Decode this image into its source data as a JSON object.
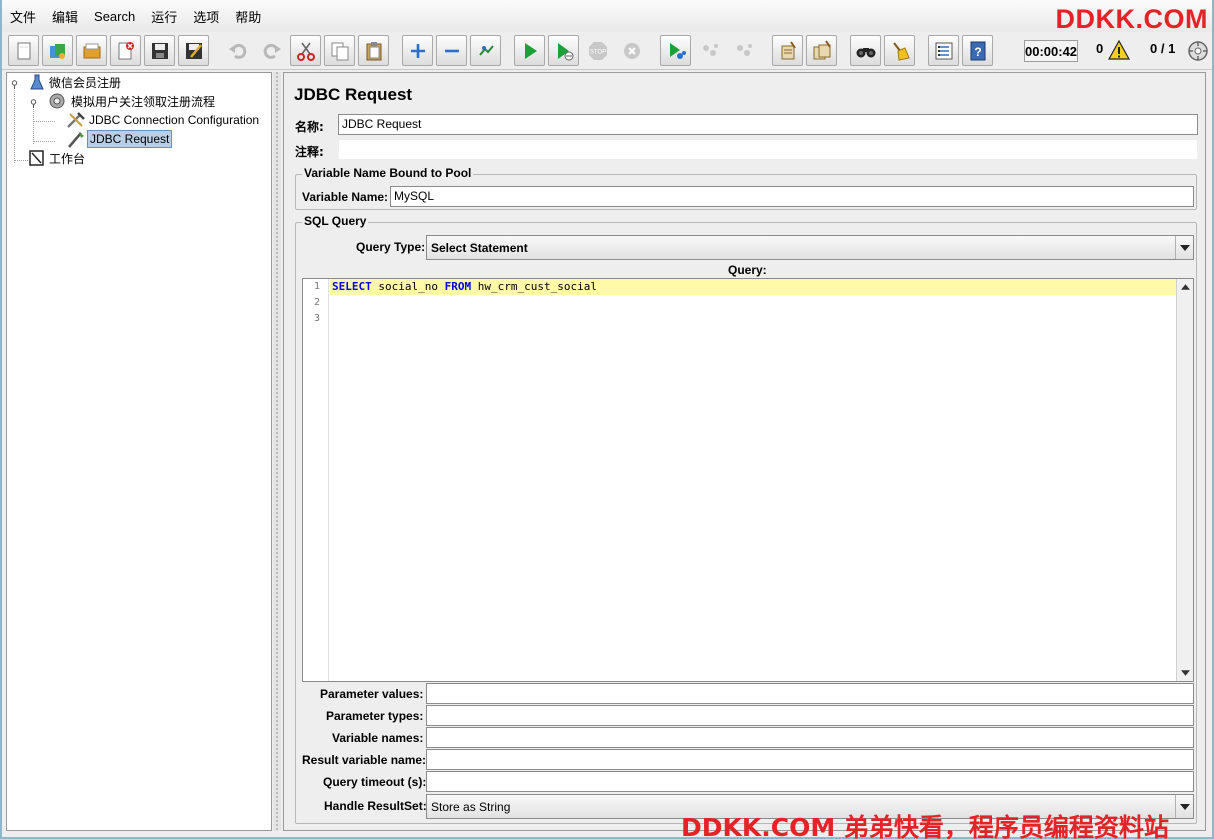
{
  "menu": {
    "items": [
      "文件",
      "编辑",
      "Search",
      "运行",
      "选项",
      "帮助"
    ]
  },
  "watermark": {
    "top": "DDKK.COM",
    "bottom": "DDKK.COM 弟弟快看，程序员编程资料站"
  },
  "toolbar": {
    "buttons": [
      "new-icon",
      "templates-icon",
      "open-icon",
      "close-icon",
      "save-icon",
      "save-as-icon",
      "undo-icon",
      "redo-icon",
      "cut-icon",
      "copy-icon",
      "paste-icon",
      "expand-icon",
      "collapse-icon",
      "toggle-icon",
      "start-icon",
      "start-no-pause-icon",
      "stop-icon",
      "shutdown-icon",
      "remote-start-icon",
      "remote-stop-icon",
      "remote-exit-icon",
      "clear-icon",
      "clear-all-icon",
      "search-icon",
      "reset-search-icon",
      "function-helper-icon",
      "help-icon"
    ],
    "timer": "00:00:42",
    "warnings": "0",
    "threads": "0 / 1"
  },
  "tree": {
    "items": [
      {
        "label": "微信会员注册",
        "icon": "test-plan-icon"
      },
      {
        "label": "模拟用户关注领取注册流程",
        "icon": "thread-group-icon"
      },
      {
        "label": "JDBC Connection Configuration",
        "icon": "config-element-icon"
      },
      {
        "label": "JDBC Request",
        "icon": "sampler-icon",
        "selected": true
      },
      {
        "label": "工作台",
        "icon": "workbench-icon"
      }
    ]
  },
  "panel": {
    "title": "JDBC Request",
    "name_label": "名称:",
    "name_value": "JDBC Request",
    "comment_label": "注释:",
    "comment_value": "",
    "pool_group_title": "Variable Name Bound to Pool",
    "variable_name_label": "Variable Name:",
    "variable_name_value": "MySQL",
    "sql_group_title": "SQL Query",
    "query_type_label": "Query Type:",
    "query_type_value": "Select Statement",
    "query_label": "Query:",
    "query": {
      "line_numbers": [
        "1",
        "2",
        "3"
      ],
      "line1_kw1": "SELECT",
      "line1_t1": " social_no ",
      "line1_kw2": "FROM",
      "line1_t2": " hw_crm_cust_social"
    },
    "parameter_values_label": "Parameter values:",
    "parameter_values": "",
    "parameter_types_label": "Parameter types:",
    "parameter_types": "",
    "variable_names_label": "Variable names:",
    "variable_names": "",
    "result_variable_label": "Result variable name:",
    "result_variable": "",
    "query_timeout_label": "Query timeout (s):",
    "query_timeout": "",
    "handle_resultset_label": "Handle ResultSet:",
    "handle_resultset_value": "Store as String"
  }
}
